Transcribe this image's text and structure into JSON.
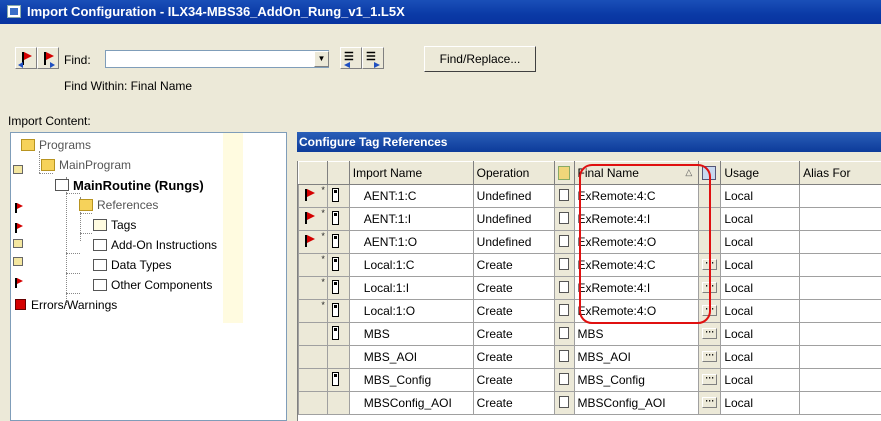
{
  "window": {
    "title": "Import Configuration - ILX34-MBS36_AddOn_Rung_v1_1.L5X"
  },
  "find": {
    "label": "Find:",
    "value": "",
    "find_within": "Find Within: Final Name",
    "find_replace_label": "Find/Replace..."
  },
  "import_content_label": "Import Content:",
  "tree": {
    "programs": "Programs",
    "main_program": "MainProgram",
    "main_routine": "MainRoutine (Rungs)",
    "references": "References",
    "tags": "Tags",
    "add_on": "Add-On Instructions",
    "data_types": "Data Types",
    "other": "Other Components",
    "errors": "Errors/Warnings"
  },
  "grid": {
    "title": "Configure Tag References",
    "columns": [
      "Import Name",
      "Operation",
      "Final Name",
      "Usage",
      "Alias For"
    ],
    "rows": [
      {
        "import_name": "AENT:1:C",
        "operation": "Undefined",
        "final_name": "ExRemote:4:C",
        "usage": "Local",
        "flag": true,
        "tag": true,
        "ellipsis": false
      },
      {
        "import_name": "AENT:1:I",
        "operation": "Undefined",
        "final_name": "ExRemote:4:I",
        "usage": "Local",
        "flag": true,
        "tag": true,
        "ellipsis": false
      },
      {
        "import_name": "AENT:1:O",
        "operation": "Undefined",
        "final_name": "ExRemote:4:O",
        "usage": "Local",
        "flag": true,
        "tag": true,
        "ellipsis": false
      },
      {
        "import_name": "Local:1:C",
        "operation": "Create",
        "final_name": "ExRemote:4:C",
        "usage": "Local",
        "flag": false,
        "tag": true,
        "ellipsis": true
      },
      {
        "import_name": "Local:1:I",
        "operation": "Create",
        "final_name": "ExRemote:4:I",
        "usage": "Local",
        "flag": false,
        "tag": true,
        "ellipsis": true
      },
      {
        "import_name": "Local:1:O",
        "operation": "Create",
        "final_name": "ExRemote:4:O",
        "usage": "Local",
        "flag": false,
        "tag": true,
        "ellipsis": true
      },
      {
        "import_name": "MBS",
        "operation": "Create",
        "final_name": "MBS",
        "usage": "Local",
        "flag": false,
        "tag": true,
        "ellipsis": true
      },
      {
        "import_name": "MBS_AOI",
        "operation": "Create",
        "final_name": "MBS_AOI",
        "usage": "Local",
        "flag": false,
        "tag": false,
        "ellipsis": true
      },
      {
        "import_name": "MBS_Config",
        "operation": "Create",
        "final_name": "MBS_Config",
        "usage": "Local",
        "flag": false,
        "tag": true,
        "ellipsis": true
      },
      {
        "import_name": "MBSConfig_AOI",
        "operation": "Create",
        "final_name": "MBSConfig_AOI",
        "usage": "Local",
        "flag": false,
        "tag": false,
        "ellipsis": true
      }
    ]
  },
  "colors": {
    "title_bar": "#0a3aa6",
    "highlight": "#e01010",
    "flag": "#d40000"
  },
  "icons": [
    "prev-flag-icon",
    "next-flag-icon",
    "find-prev-icon",
    "find-next-icon",
    "error-flag-icon",
    "tag-icon",
    "document-icon",
    "ellipsis-icon"
  ]
}
